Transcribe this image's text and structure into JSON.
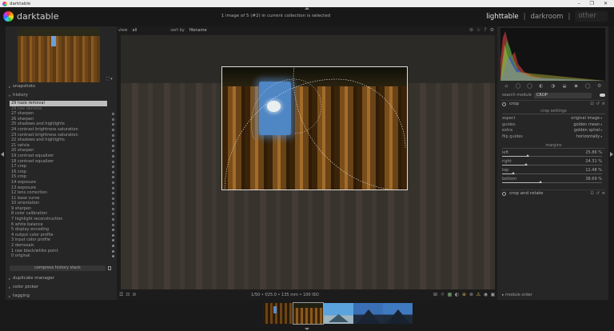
{
  "window": {
    "title": "darktable",
    "controls": [
      "–",
      "❐",
      "✕"
    ]
  },
  "header": {
    "app_name": "darktable",
    "collection_info": "1 image of 5 (#2) in current collection is selected",
    "views": {
      "lighttable": "lighttable",
      "separator": "|",
      "darkroom": "darkroom",
      "other": "other"
    }
  },
  "center_top": {
    "view_label": "view",
    "view_value": "all",
    "sort_label": "sort by",
    "sort_value": "filename"
  },
  "left": {
    "nav_icons": "⛶ ▾",
    "snapshots": "snapshots",
    "history": "history",
    "history_items": [
      {
        "label": "29 haze removal",
        "state": "sel",
        "dot": "none"
      },
      {
        "label": "28 raw denoise",
        "state": "dim",
        "dot": "none"
      },
      {
        "label": "27 sharpen",
        "state": "",
        "dot": "ring"
      },
      {
        "label": "26 sharpen",
        "state": "",
        "dot": "ring"
      },
      {
        "label": "25 shadows and highlights",
        "state": "",
        "dot": "ring"
      },
      {
        "label": "24 contrast brightness saturation",
        "state": "",
        "dot": "ring"
      },
      {
        "label": "23 contrast brightness saturation",
        "state": "",
        "dot": "ring"
      },
      {
        "label": "22 shadows and highlights",
        "state": "",
        "dot": "ring"
      },
      {
        "label": "21 velvia",
        "state": "",
        "dot": "ring"
      },
      {
        "label": "20 sharpen",
        "state": "",
        "dot": "ring"
      },
      {
        "label": "19 contrast equalizer",
        "state": "",
        "dot": "ring"
      },
      {
        "label": "18 contrast equalizer",
        "state": "",
        "dot": "ring"
      },
      {
        "label": "17 crop",
        "state": "",
        "dot": "ring"
      },
      {
        "label": "16 crop",
        "state": "",
        "dot": "ring"
      },
      {
        "label": "15 crop",
        "state": "",
        "dot": "ring"
      },
      {
        "label": "14 exposure",
        "state": "",
        "dot": "ring"
      },
      {
        "label": "13 exposure",
        "state": "",
        "dot": "ring"
      },
      {
        "label": "12 lens correction",
        "state": "",
        "dot": "ring"
      },
      {
        "label": "11 base curve",
        "state": "",
        "dot": "ring"
      },
      {
        "label": "10 orientation",
        "state": "",
        "dot": "ring"
      },
      {
        "label": "9 sharpen",
        "state": "",
        "dot": "ring"
      },
      {
        "label": "8 color calibration",
        "state": "",
        "dot": "ring"
      },
      {
        "label": "7 highlight reconstruction",
        "state": "",
        "dot": "ring"
      },
      {
        "label": "6 white balance",
        "state": "",
        "dot": "ring"
      },
      {
        "label": "5 display encoding",
        "state": "",
        "dot": "full"
      },
      {
        "label": "4 output color profile",
        "state": "",
        "dot": "full"
      },
      {
        "label": "3 input color profile",
        "state": "",
        "dot": "full"
      },
      {
        "label": "2 demosaic",
        "state": "",
        "dot": "full"
      },
      {
        "label": "1 raw black/white point",
        "state": "",
        "dot": "full"
      },
      {
        "label": "0 original",
        "state": "",
        "dot": "full"
      }
    ],
    "compress_button": "compress history stack",
    "duplicate_manager": "duplicate manager",
    "color_picker": "color picker",
    "tagging": "tagging"
  },
  "status": {
    "image_info": "1/50 • f/25.0 • 135 mm • 100 ISO",
    "left_icons": [
      "☰",
      "⊡",
      "⊘"
    ],
    "right_icons": [
      "⊞",
      "☼",
      "▦",
      "◐",
      "⊕",
      "⊗",
      "⚠",
      "◉",
      "▣"
    ],
    "right_icon_colors": [
      "#999999",
      "#999999",
      "#7fb07a",
      "#999999",
      "#d4a24a",
      "#999999",
      "#e0c05a",
      "#999999",
      "#999999"
    ]
  },
  "right": {
    "module_tab_icons": [
      "⌂",
      "◯",
      "◯",
      "◐",
      "◑",
      "◒",
      "◆",
      "◯",
      "⚙"
    ],
    "search_label": "search module",
    "search_value": "CROP",
    "crop": {
      "title": "crop",
      "settings_header": "crop settings",
      "props": [
        {
          "label": "aspect",
          "value": "original image"
        },
        {
          "label": "guides",
          "value": "golden mean"
        },
        {
          "label": "extra",
          "value": "golden spiral"
        },
        {
          "label": "flip guides",
          "value": "horizontally"
        }
      ],
      "margins_header": "margins",
      "sliders": [
        {
          "label": "left",
          "value": "25.86 %",
          "fraction": 0.2586
        },
        {
          "label": "right",
          "value": "24.31 %",
          "fraction": 0.2431
        },
        {
          "label": "top",
          "value": "11.48 %",
          "fraction": 0.1148
        },
        {
          "label": "bottom",
          "value": "38.69 %",
          "fraction": 0.3869
        }
      ]
    },
    "crop_rotate": "crop and rotate",
    "module_order": "module order"
  }
}
